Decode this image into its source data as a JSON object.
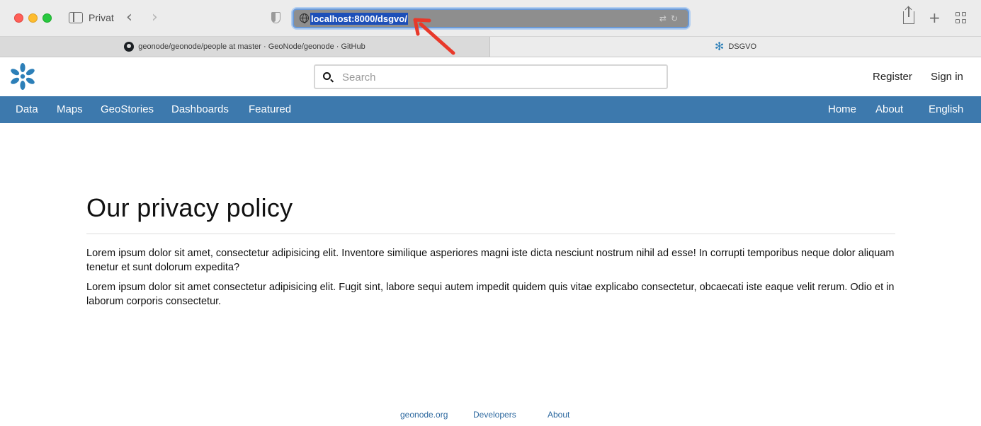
{
  "browser": {
    "window_label": "Privat",
    "url": "localhost:8000/dsgvo/",
    "tabs": [
      {
        "title": "geonode/geonode/people at master · GeoNode/geonode · GitHub",
        "icon": "github-icon"
      },
      {
        "title": "DSGVO",
        "icon": "geonode-icon"
      }
    ]
  },
  "header": {
    "search_placeholder": "Search",
    "register_label": "Register",
    "signin_label": "Sign in"
  },
  "nav": {
    "left": [
      "Data",
      "Maps",
      "GeoStories",
      "Dashboards",
      "Featured"
    ],
    "right": [
      "Home",
      "About",
      "English"
    ]
  },
  "main": {
    "title": "Our privacy policy",
    "paragraphs": [
      "Lorem ipsum dolor sit amet, consectetur adipisicing elit. Inventore similique asperiores magni iste dicta nesciunt nostrum nihil ad esse! In corrupti temporibus neque dolor aliquam tenetur et sunt dolorum expedita?",
      "Lorem ipsum dolor sit amet consectetur adipisicing elit. Fugit sint, labore sequi autem impedit quidem quis vitae explicabo consectetur, obcaecati iste eaque velit rerum. Odio et in laborum corporis consectetur."
    ]
  },
  "footer": {
    "links": [
      "geonode.org",
      "Developers",
      "About"
    ]
  },
  "colors": {
    "navbar": "#3d79ad",
    "logo": "#2c7fb8",
    "footer_link": "#2f6aa0",
    "annotation_arrow": "#e8392a"
  }
}
